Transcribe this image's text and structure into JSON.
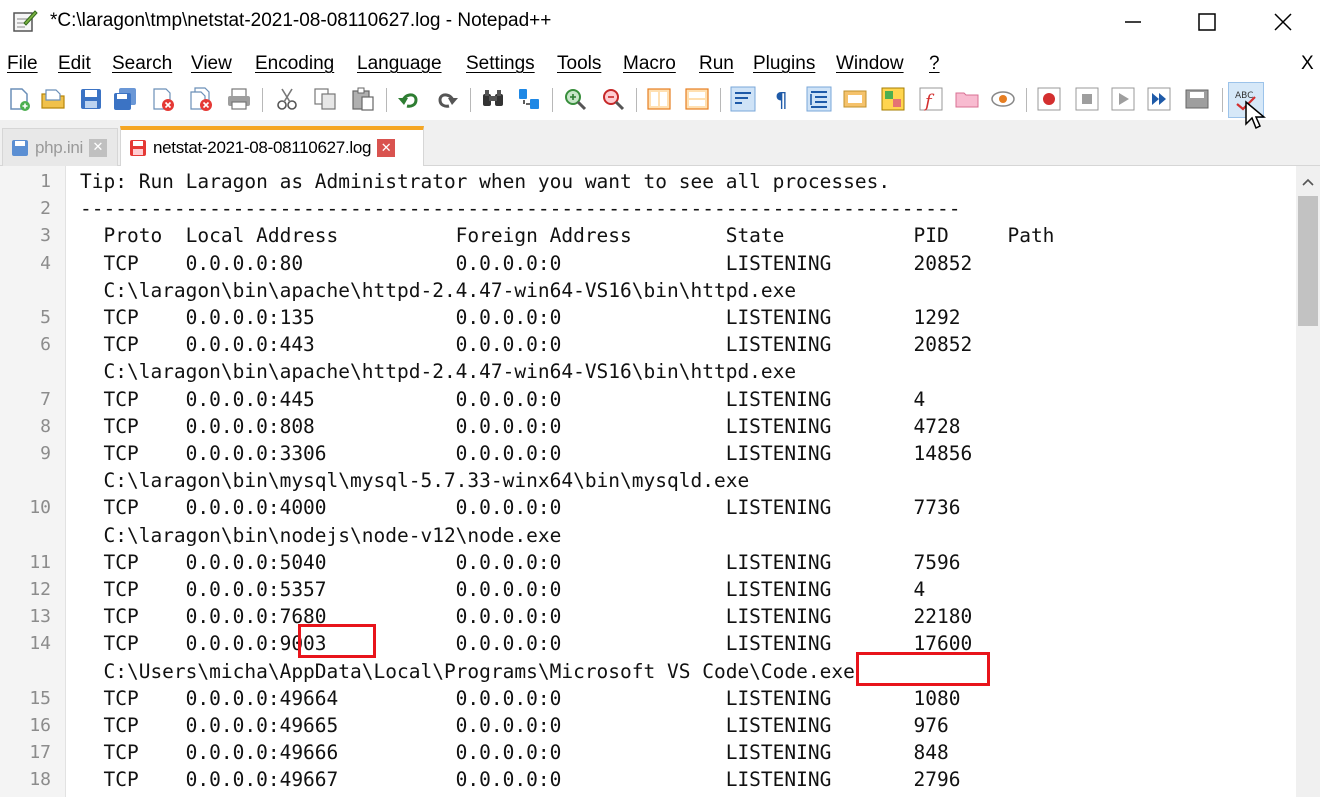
{
  "window": {
    "title": "*C:\\laragon\\tmp\\netstat-2021-08-08110627.log - Notepad++",
    "minimize_label": "minimize",
    "maximize_label": "maximize",
    "close_label": "close"
  },
  "menu": {
    "items": [
      "File",
      "Edit",
      "Search",
      "View",
      "Encoding",
      "Language",
      "Settings",
      "Tools",
      "Macro",
      "Run",
      "Plugins",
      "Window",
      "?"
    ],
    "close_document": "X"
  },
  "toolbar": {
    "icons": [
      "new-file-icon",
      "open-file-icon",
      "save-icon",
      "save-all-icon",
      "close-icon",
      "close-all-icon",
      "print-icon",
      "cut-icon",
      "copy-icon",
      "paste-icon",
      "undo-icon",
      "redo-icon",
      "find-icon",
      "replace-icon",
      "zoom-in-icon",
      "zoom-out-icon",
      "sync-vertical-icon",
      "sync-horizontal-icon",
      "word-wrap-icon",
      "show-all-chars-icon",
      "indent-guide-icon",
      "user-lang-icon",
      "doc-map-icon",
      "function-list-icon",
      "folder-workspace-icon",
      "monitoring-icon",
      "record-macro-icon",
      "stop-macro-icon",
      "play-macro-icon",
      "run-macro-multiple-icon",
      "save-macro-icon",
      "spell-check-icon"
    ]
  },
  "tabs": [
    {
      "label": "php.ini",
      "active": false
    },
    {
      "label": "netstat-2021-08-08110627.log",
      "active": true
    }
  ],
  "editor": {
    "rows": [
      {
        "num": "1",
        "text": "Tip: Run Laragon as Administrator when you want to see all processes."
      },
      {
        "num": "2",
        "text": "---------------------------------------------------------------------------"
      },
      {
        "num": "3",
        "text": "  Proto  Local Address          Foreign Address        State           PID     Path"
      },
      {
        "num": "4",
        "text": "  TCP    0.0.0.0:80             0.0.0.0:0              LISTENING       20852"
      },
      {
        "num": "",
        "text": "  C:\\laragon\\bin\\apache\\httpd-2.4.47-win64-VS16\\bin\\httpd.exe"
      },
      {
        "num": "5",
        "text": "  TCP    0.0.0.0:135            0.0.0.0:0              LISTENING       1292"
      },
      {
        "num": "6",
        "text": "  TCP    0.0.0.0:443            0.0.0.0:0              LISTENING       20852"
      },
      {
        "num": "",
        "text": "  C:\\laragon\\bin\\apache\\httpd-2.4.47-win64-VS16\\bin\\httpd.exe"
      },
      {
        "num": "7",
        "text": "  TCP    0.0.0.0:445            0.0.0.0:0              LISTENING       4"
      },
      {
        "num": "8",
        "text": "  TCP    0.0.0.0:808            0.0.0.0:0              LISTENING       4728"
      },
      {
        "num": "9",
        "text": "  TCP    0.0.0.0:3306           0.0.0.0:0              LISTENING       14856"
      },
      {
        "num": "",
        "text": "  C:\\laragon\\bin\\mysql\\mysql-5.7.33-winx64\\bin\\mysqld.exe"
      },
      {
        "num": "10",
        "text": "  TCP    0.0.0.0:4000           0.0.0.0:0              LISTENING       7736"
      },
      {
        "num": "",
        "text": "  C:\\laragon\\bin\\nodejs\\node-v12\\node.exe"
      },
      {
        "num": "11",
        "text": "  TCP    0.0.0.0:5040           0.0.0.0:0              LISTENING       7596"
      },
      {
        "num": "12",
        "text": "  TCP    0.0.0.0:5357           0.0.0.0:0              LISTENING       4"
      },
      {
        "num": "13",
        "text": "  TCP    0.0.0.0:7680           0.0.0.0:0              LISTENING       22180"
      },
      {
        "num": "14",
        "text": "  TCP    0.0.0.0:9003           0.0.0.0:0              LISTENING       17600"
      },
      {
        "num": "",
        "text": "  C:\\Users\\micha\\AppData\\Local\\Programs\\Microsoft VS Code\\Code.exe"
      },
      {
        "num": "15",
        "text": "  TCP    0.0.0.0:49664          0.0.0.0:0              LISTENING       1080"
      },
      {
        "num": "16",
        "text": "  TCP    0.0.0.0:49665          0.0.0.0:0              LISTENING       976"
      },
      {
        "num": "17",
        "text": "  TCP    0.0.0.0:49666          0.0.0.0:0              LISTENING       848"
      },
      {
        "num": "18",
        "text": "  TCP    0.0.0.0:49667          0.0.0.0:0              LISTENING       2796"
      }
    ]
  },
  "colors": {
    "highlight_border": "#e8141b",
    "active_tab_accent": "#f5a623"
  }
}
